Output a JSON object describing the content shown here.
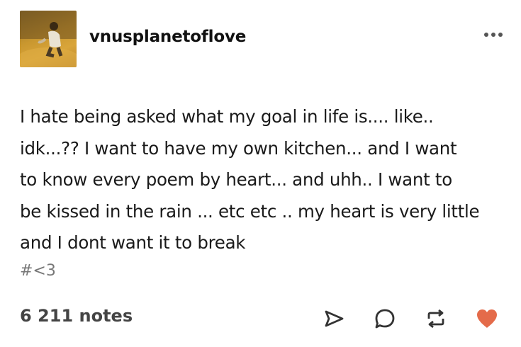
{
  "post": {
    "username": "vnusplanetoflove",
    "body_lines": [
      "I hate being asked what my goal in life is.... like..",
      "idk...?? I want to have my own kitchen... and I want",
      "to know every poem by heart... and uhh.. I want to",
      "be kissed in the rain ... etc etc .. my heart is very little",
      "and I dont want it to break"
    ],
    "tags": "#<3",
    "notes": "6 211 notes"
  },
  "icons": {
    "more": "more-options-icon",
    "share": "share-icon",
    "reply": "reply-icon",
    "reblog": "reblog-icon",
    "like": "heart-icon"
  },
  "colors": {
    "like": "#e46b4a",
    "icon": "#333333",
    "muted": "#777777"
  }
}
